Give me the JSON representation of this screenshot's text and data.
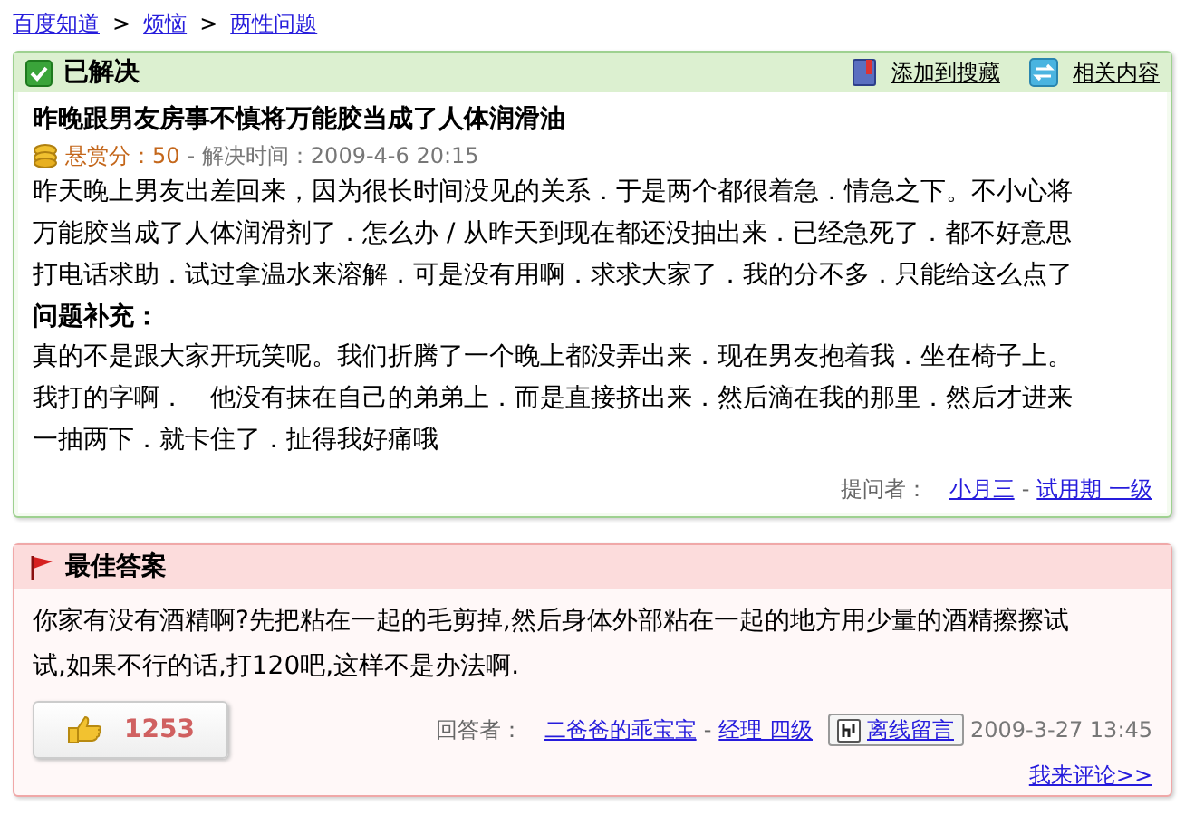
{
  "breadcrumb": {
    "items": [
      {
        "label": "百度知道"
      },
      {
        "label": "烦恼"
      },
      {
        "label": "两性问题"
      }
    ],
    "separators": [
      ">",
      ">"
    ]
  },
  "question": {
    "status": "已解决",
    "actions": [
      {
        "label": "添加到搜藏",
        "kind": "bookmark"
      },
      {
        "label": "相关内容",
        "kind": "related"
      }
    ],
    "title": "昨晚跟男友房事不慎将万能胶当成了人体润滑油",
    "reward": "悬赏分：50",
    "solved": "- 解决时间：2009-4-6 20:15",
    "body": "昨天晚上男友出差回来，因为很长时间没见的关系．于是两个都很着急．情急之下。不小心将万能胶当成了人体润滑剂了．怎么办 / 从昨天到现在都还没抽出来．已经急死了．都不好意思打电话求助．试过拿温水来溶解．可是没有用啊．求求大家了．我的分不多．只能给这么点了",
    "supplement_heading": "问题补充：",
    "supplement": "真的不是跟大家开玩笑呢。我们折腾了一个晚上都没弄出来．现在男友抱着我．坐在椅子上。我打的字啊．　他没有抹在自己的弟弟上．而是直接挤出来．然后滴在我的那里．然后才进来一抽两下．就卡住了．扯得我好痛哦",
    "asker": {
      "label": "提问者：",
      "name": "小月三",
      "separator": "-",
      "rank": "试用期 一级"
    }
  },
  "answer": {
    "heading": "最佳答案",
    "body": "你家有没有酒精啊?先把粘在一起的毛剪掉,然后身体外部粘在一起的地方用少量的酒精擦擦试试,如果不行的话,打120吧,这样不是办法啊.",
    "votes": "1253",
    "answerer": {
      "label": "回答者：",
      "name": "二爸爸的乖宝宝",
      "separator": "-",
      "rank": "经理 四级"
    },
    "message_button": "离线留言",
    "time": "2009-3-27 13:45",
    "comment_link": "我来评论>>"
  }
}
